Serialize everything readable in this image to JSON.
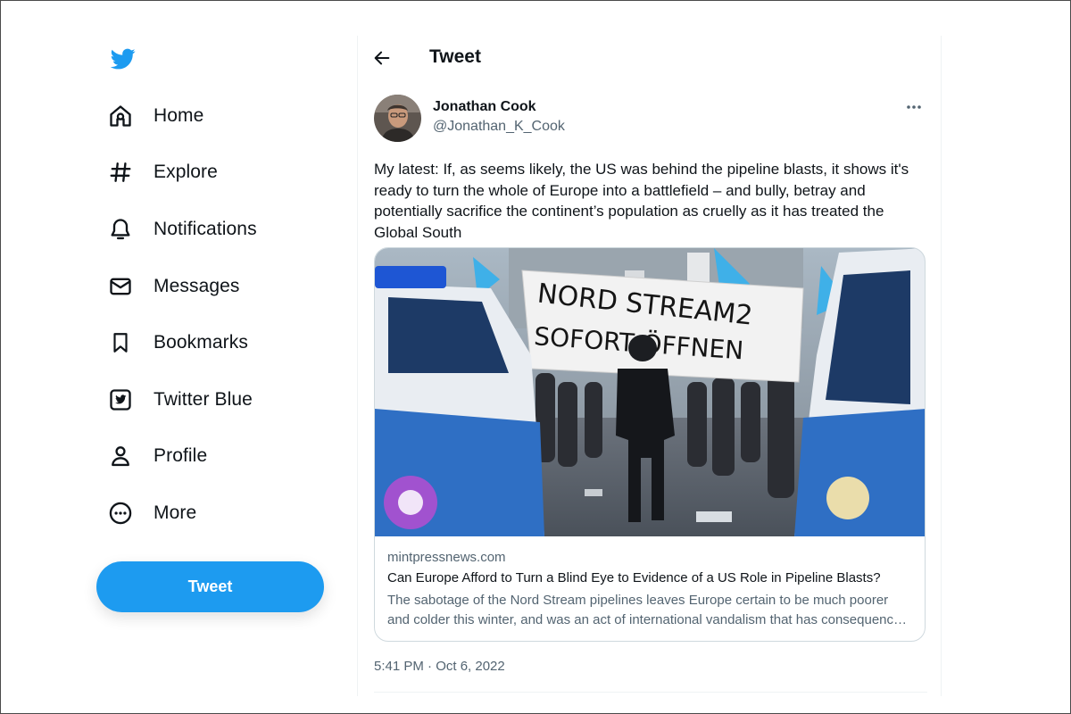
{
  "colors": {
    "brand": "#1d9bf0",
    "text": "#0f1419",
    "secondary_text": "#536471",
    "border": "#cfd9de"
  },
  "sidebar": {
    "logo_icon": "twitter-bird-icon",
    "items": [
      {
        "label": "Home",
        "icon": "home-icon"
      },
      {
        "label": "Explore",
        "icon": "hashtag-icon"
      },
      {
        "label": "Notifications",
        "icon": "bell-icon"
      },
      {
        "label": "Messages",
        "icon": "envelope-icon"
      },
      {
        "label": "Bookmarks",
        "icon": "bookmark-icon"
      },
      {
        "label": "Twitter Blue",
        "icon": "twitter-blue-icon"
      },
      {
        "label": "Profile",
        "icon": "person-icon"
      },
      {
        "label": "More",
        "icon": "more-circle-icon"
      }
    ],
    "tweet_button_label": "Tweet"
  },
  "header": {
    "back_icon": "arrow-left-icon",
    "title": "Tweet"
  },
  "tweet": {
    "author_name": "Jonathan Cook",
    "author_handle": "@Jonathan_K_Cook",
    "more_icon": "more-horizontal-icon",
    "text": "My latest: If, as seems likely, the US was behind the pipeline blasts, it shows it's ready to turn the whole of Europe into a battlefield – and bully, betray and potentially sacrifice the continent’s population as cruelly as it has treated the Global South",
    "card": {
      "image_banner_line1": "NORD STREAM2",
      "image_banner_line2": "SOFORT ÖFFNEN",
      "domain": "mintpressnews.com",
      "title": "Can Europe Afford to Turn a Blind Eye to Evidence of a US Role in Pipeline Blasts?",
      "description": "The sabotage of the Nord Stream pipelines leaves Europe certain to be much poorer and colder this winter, and was an act of international vandalism that has consequences for years to come."
    },
    "timestamp": "5:41 PM · Oct 6, 2022"
  }
}
